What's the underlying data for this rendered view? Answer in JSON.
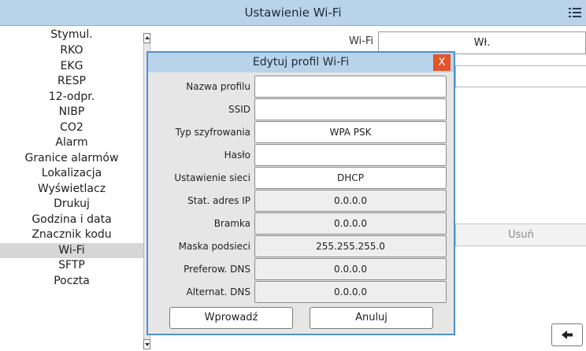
{
  "header": {
    "title": "Ustawienie Wi-Fi",
    "menu_icon": "list-menu-icon"
  },
  "sidebar": {
    "items": [
      {
        "label": "Stymul."
      },
      {
        "label": "RKO"
      },
      {
        "label": "EKG"
      },
      {
        "label": "RESP"
      },
      {
        "label": "12-odpr."
      },
      {
        "label": "NIBP"
      },
      {
        "label": "CO2"
      },
      {
        "label": "Alarm"
      },
      {
        "label": "Granice alarmów"
      },
      {
        "label": "Lokalizacja"
      },
      {
        "label": "Wyświetlacz"
      },
      {
        "label": "Drukuj"
      },
      {
        "label": "Godzina i data"
      },
      {
        "label": "Znacznik kodu"
      },
      {
        "label": "Wi-Fi",
        "active": true
      },
      {
        "label": "SFTP"
      },
      {
        "label": "Poczta"
      }
    ]
  },
  "background": {
    "wifi_label": "Wi-Fi",
    "wifi_value": "Wł.",
    "delete_label": "Usuń",
    "back_icon": "arrow-left-icon"
  },
  "dialog": {
    "title": "Edytuj profil Wi-Fi",
    "close_label": "X",
    "fields": [
      {
        "label": "Nazwa profilu",
        "value": "",
        "readonly": false
      },
      {
        "label": "SSID",
        "value": "",
        "readonly": false
      },
      {
        "label": "Typ szyfrowania",
        "value": "WPA PSK",
        "readonly": false
      },
      {
        "label": "Hasło",
        "value": "",
        "readonly": false
      },
      {
        "label": "Ustawienie sieci",
        "value": "DHCP",
        "readonly": false
      },
      {
        "label": "Stat. adres IP",
        "value": "0.0.0.0",
        "readonly": true
      },
      {
        "label": "Bramka",
        "value": "0.0.0.0",
        "readonly": true
      },
      {
        "label": "Maska podsieci",
        "value": "255.255.255.0",
        "readonly": true
      },
      {
        "label": "Preferow. DNS",
        "value": "0.0.0.0",
        "readonly": true
      },
      {
        "label": "Alternat. DNS",
        "value": "0.0.0.0",
        "readonly": true
      }
    ],
    "enter_label": "Wprowadź",
    "cancel_label": "Anuluj"
  }
}
